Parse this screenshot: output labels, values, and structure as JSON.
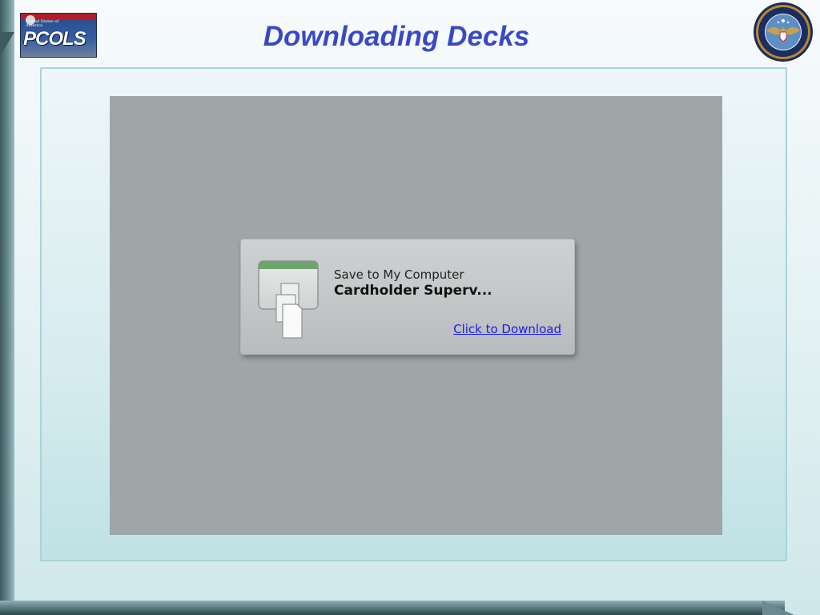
{
  "header": {
    "title": "Downloading Decks",
    "logo_text": "PCOLS",
    "logo_small_text": "United States of America"
  },
  "download": {
    "save_label": "Save to My Computer",
    "file_name": "Cardholder Superv...",
    "link_label": "Click to Download"
  },
  "icons": {
    "logo": "pcols-logo",
    "seal": "dod-seal-icon",
    "file": "documents-icon"
  },
  "colors": {
    "title": "#3b48c6",
    "link": "#1d1de0",
    "screen": "#9fa6a8"
  }
}
